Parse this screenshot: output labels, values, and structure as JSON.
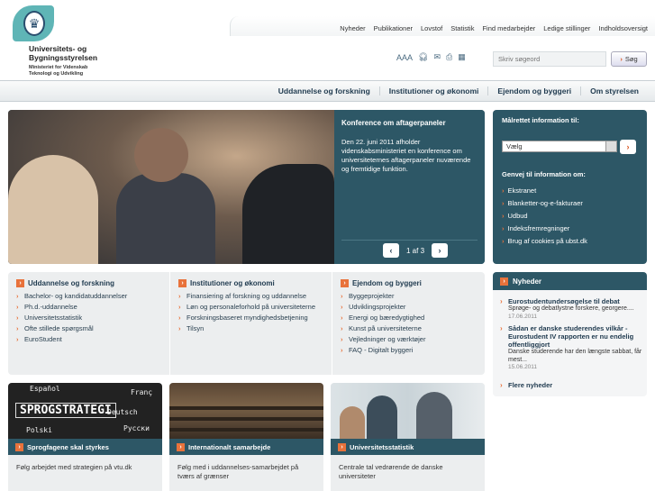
{
  "header": {
    "org_name": "Universitets- og Bygningsstyrelsen",
    "org_sub": "Ministeriet for Videnskab Teknologi og Udvikling",
    "top_links": [
      "Nyheder",
      "Publikationer",
      "Lovstof",
      "Statistik",
      "Find medarbejder",
      "Ledige stillinger",
      "Indholdsoversigt"
    ],
    "text_size": "AAA",
    "search_placeholder": "Skriv søgeord",
    "search_button": "Søg"
  },
  "nav": [
    "Uddannelse og forskning",
    "Institutioner og økonomi",
    "Ejendom og byggeri",
    "Om styrelsen"
  ],
  "hero": {
    "title": "Konference om aftagerpaneler",
    "body": "Den 22. juni 2011 afholder videnskabsministeriet en konference om universiteternes aftagerpaneler nuværende og fremtidige funktion.",
    "pager": "1 af 3"
  },
  "right_panel": {
    "heading": "Målrettet information til:",
    "select_value": "Vælg",
    "shortcuts_heading": "Genvej til information om:",
    "shortcuts": [
      "Ekstranet",
      "Blanketter-og-e-fakturaer",
      "Udbud",
      "Indeksfremregninger",
      "Brug af cookies på ubst.dk"
    ]
  },
  "columns": [
    {
      "heading": "Uddannelse og forskning",
      "items": [
        "Bachelor- og kandidatuddannelser",
        "Ph.d.-uddannelse",
        "Universitetsstatistik",
        "Ofte stillede spørgsmål",
        "EuroStudent"
      ]
    },
    {
      "heading": "Institutioner og økonomi",
      "items": [
        "Finansiering af forskning og uddannelse",
        "Løn og personaleforhold på universiteterne",
        "Forskningsbaseret myndighedsbetjening",
        "Tilsyn"
      ]
    },
    {
      "heading": "Ejendom og byggeri",
      "items": [
        "Byggeprojekter",
        "Udviklingsprojekter",
        "Energi og bæredygtighed",
        "Kunst på universiteterne",
        "Vejledninger og værktøjer",
        "FAQ - Digitalt byggeri"
      ]
    }
  ],
  "news": {
    "heading": "Nyheder",
    "items": [
      {
        "title": "Eurostudentundersøgelse til debat",
        "desc": "Sprøge- og debatlystne forskere, georgere....",
        "date": "17.06.2011"
      },
      {
        "title": "Sådan er danske studerendes vilkår - Eurostudent IV rapporten er nu endelig offentliggjort",
        "desc": "Danske studerende har den længste sabbat, får mest...",
        "date": "15.06.2011"
      }
    ],
    "more": "Flere nyheder"
  },
  "tiles": [
    {
      "bar": "Sprogfagene skal styrkes",
      "desc": "Følg arbejdet med strategien på vtu.dk",
      "chalk_big": "SPROGSTRATEGI",
      "chalk_words": [
        "Español",
        "Franç",
        "Deutsch",
        "Polski",
        "Pусски"
      ]
    },
    {
      "bar": "Internationalt samarbejde",
      "desc": "Følg med i uddannelses-samarbejdet på tværs af grænser"
    },
    {
      "bar": "Universitetsstatistik",
      "desc": "Centrale tal vedrørende de danske universiteter"
    }
  ]
}
